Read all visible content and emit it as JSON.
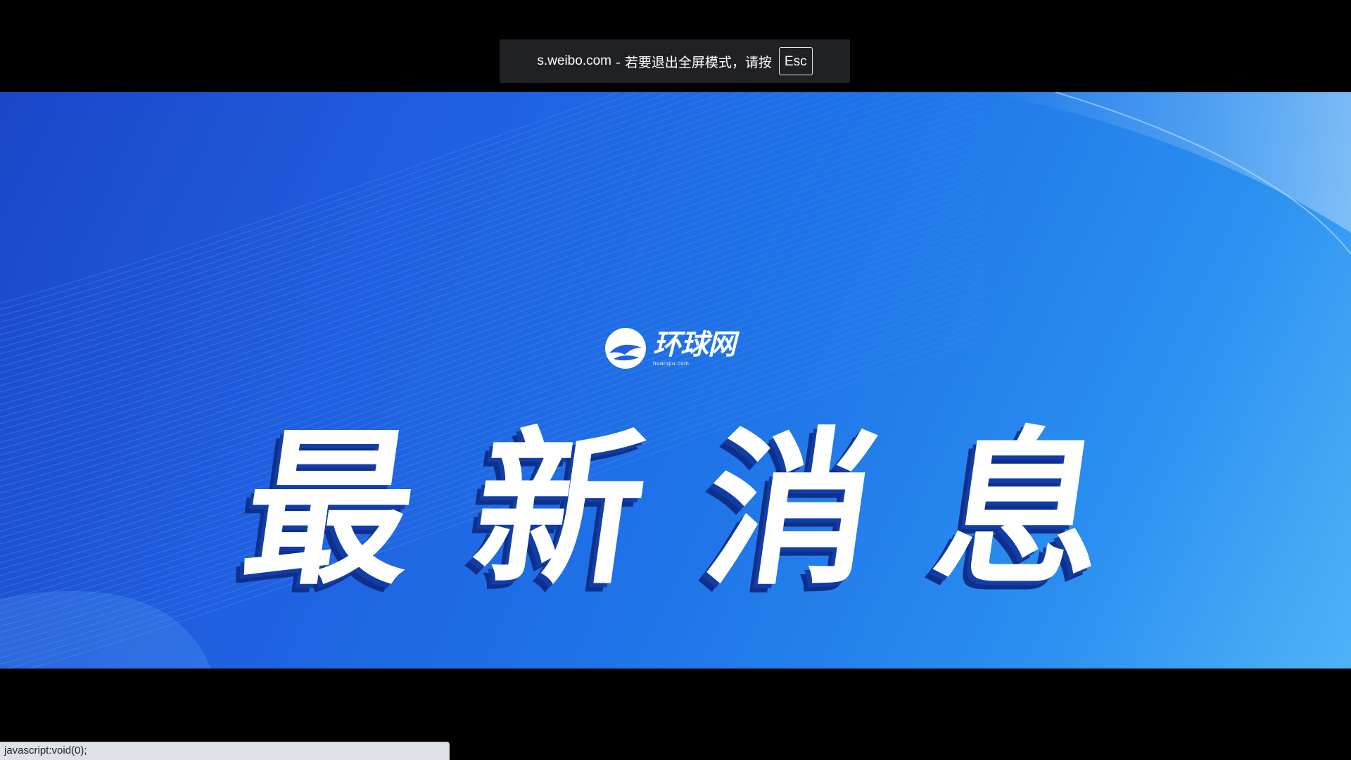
{
  "fullscreen_notice": {
    "host": "s.weibo.com",
    "message": "- 若要退出全屏模式，请按",
    "key": "Esc"
  },
  "video": {
    "logo": {
      "text": "环球网",
      "subtext": "huanqiu.com"
    },
    "headline": [
      "最",
      "新",
      "消",
      "息"
    ],
    "colors": {
      "background_deep": "#1c46c8",
      "background_mid": "#1f74e8",
      "background_light": "#4fb3f7",
      "text": "#ffffff",
      "text_shadow": "#123da6"
    }
  },
  "status_bar": {
    "url": "javascript:void(0);"
  }
}
